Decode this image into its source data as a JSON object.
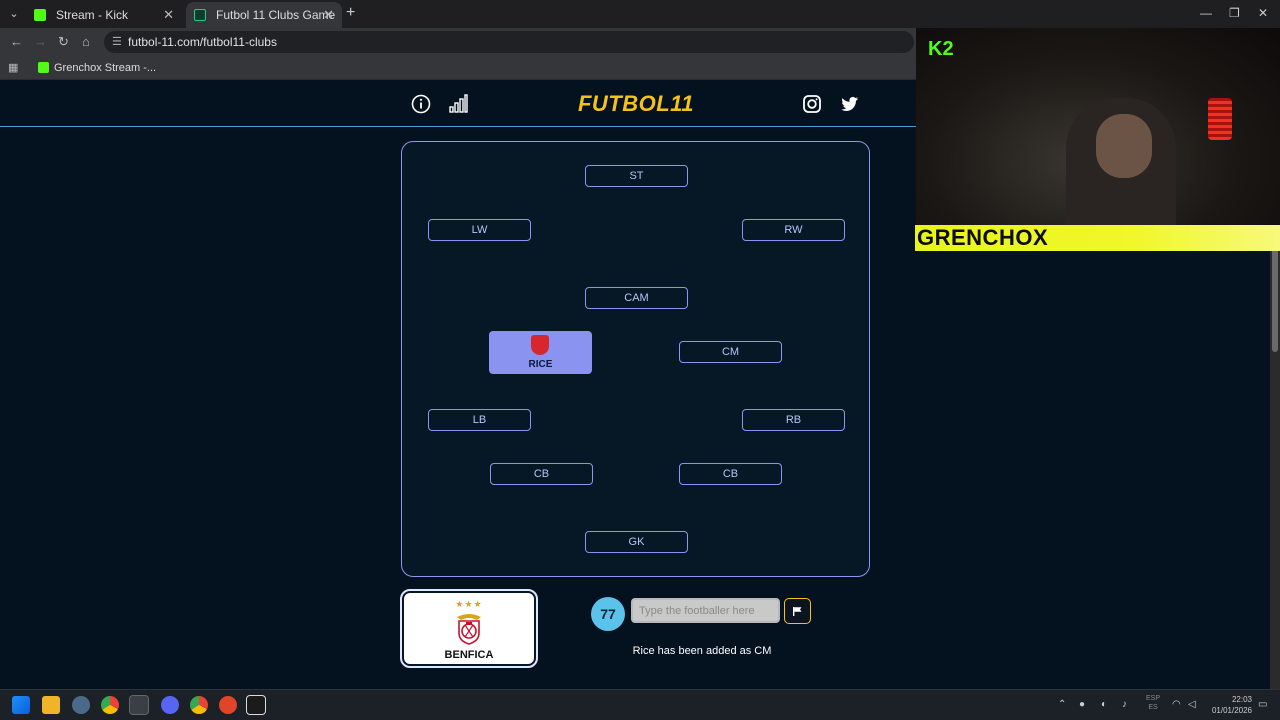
{
  "browser": {
    "tabs": [
      {
        "title": "Stream - Kick Dashboard",
        "favicon_color": "#53fc18"
      },
      {
        "title": "Futbol 11 Clubs Game",
        "favicon_color": "#0b3d2a"
      }
    ],
    "url": "futbol-11.com/futbol11-clubs",
    "bookmark": "Grenchox Stream -..."
  },
  "header": {
    "logo": "FUTBOL11",
    "icons": [
      "info-icon",
      "stats-icon",
      "instagram-icon",
      "twitter-icon"
    ]
  },
  "pitch": {
    "positions": {
      "st": "ST",
      "lw": "LW",
      "rw": "RW",
      "cam": "CAM",
      "cm_right": "CM",
      "lb": "LB",
      "rb": "RB",
      "cb_left": "CB",
      "cb_right": "CB",
      "gk": "GK"
    },
    "filled": {
      "name": "RICE",
      "club_crest": "arsenal-crest"
    }
  },
  "club": {
    "name": "BENFICA",
    "stars": "★★★"
  },
  "game": {
    "remaining": "77",
    "input_placeholder": "Type the footballer here",
    "status": "Rice has been added as CM"
  },
  "stream": {
    "streamer": "GRENCHOX",
    "kick_badge": "K2"
  },
  "taskbar": {
    "lang_top": "ESP",
    "lang_bottom": "ES",
    "time": "22:03",
    "date": "01/01/2026"
  },
  "colors": {
    "accent": "#8f94f0",
    "logo": "#f6c21a",
    "header_line": "#4f9bd6",
    "filled_card": "#8a93f0",
    "count_badge": "#5bc2ea"
  }
}
